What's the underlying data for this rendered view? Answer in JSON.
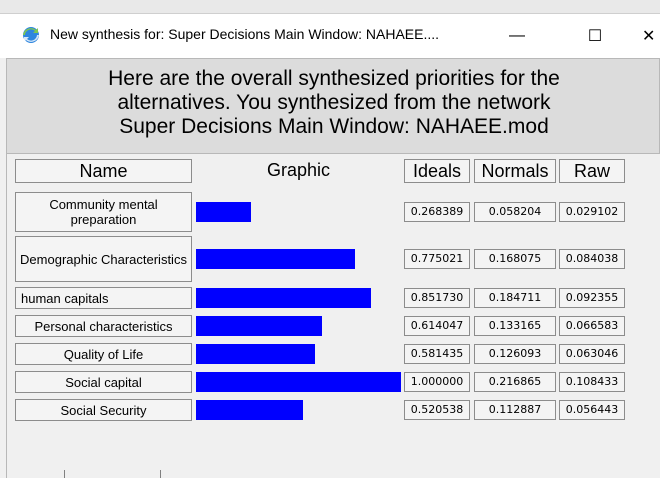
{
  "window": {
    "title": "New synthesis for: Super Decisions Main Window: NAHAEE....",
    "minimize": "—",
    "maximize": "☐",
    "close": "✕"
  },
  "header": {
    "line1": "Here are the overall synthesized priorities for the",
    "line2": "alternatives.  You synthesized from the network",
    "line3": "Super Decisions Main Window: NAHAEE.mod"
  },
  "columns": {
    "name": "Name",
    "graphic": "Graphic",
    "ideals": "Ideals",
    "normals": "Normals",
    "raw": "Raw"
  },
  "bar_color": "#0000ff",
  "rows": [
    {
      "name": "Community mental preparation",
      "ideal_value": 0.268389,
      "ideals": "0.268389",
      "normals": "0.058204",
      "raw": "0.029102"
    },
    {
      "name": "Demographic Characteristics",
      "ideal_value": 0.775021,
      "ideals": "0.775021",
      "normals": "0.168075",
      "raw": "0.084038"
    },
    {
      "name": "human capitals",
      "ideal_value": 0.85173,
      "ideals": "0.851730",
      "normals": "0.184711",
      "raw": "0.092355"
    },
    {
      "name": "Personal characteristics",
      "ideal_value": 0.614047,
      "ideals": "0.614047",
      "normals": "0.133165",
      "raw": "0.066583"
    },
    {
      "name": "Quality of Life",
      "ideal_value": 0.581435,
      "ideals": "0.581435",
      "normals": "0.126093",
      "raw": "0.063046"
    },
    {
      "name": "Social capital",
      "ideal_value": 1.0,
      "ideals": "1.000000",
      "normals": "0.216865",
      "raw": "0.108433"
    },
    {
      "name": "Social Security",
      "ideal_value": 0.520538,
      "ideals": "0.520538",
      "normals": "0.112887",
      "raw": "0.056443"
    }
  ]
}
